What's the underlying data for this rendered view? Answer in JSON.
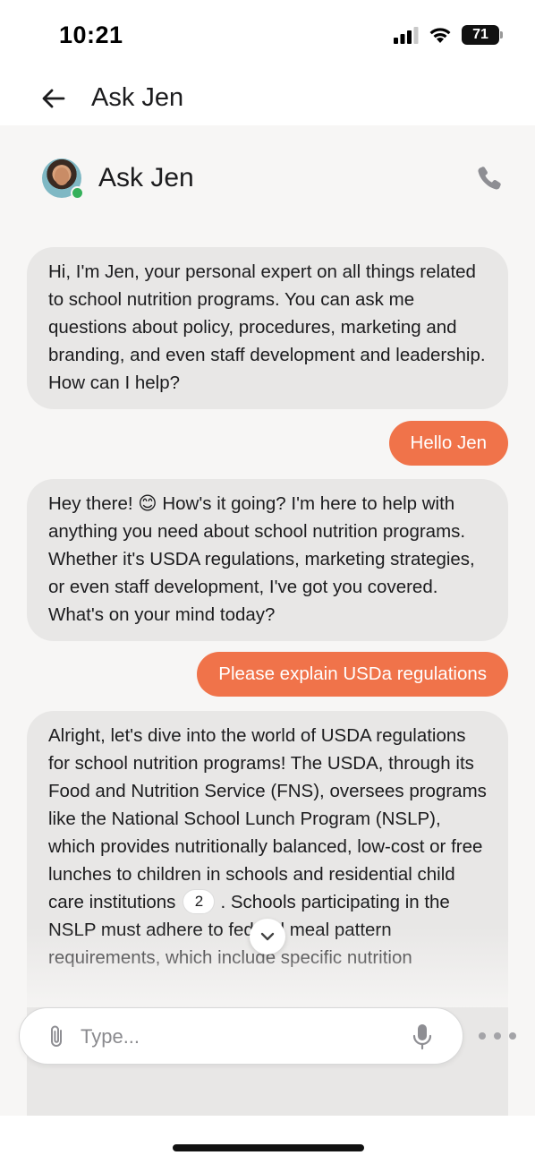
{
  "status_bar": {
    "time": "10:21",
    "battery": "71"
  },
  "nav": {
    "title": "Ask Jen",
    "back_icon": "arrow-left-icon"
  },
  "chat": {
    "agent_name": "Ask Jen",
    "agent_status": "online",
    "call_icon": "phone-icon",
    "messages": [
      {
        "role": "bot",
        "text": "Hi, I'm Jen, your personal expert on all things related to school nutrition programs. You can ask me questions about policy, procedures, marketing and branding, and even staff development and leadership. How can I help?"
      },
      {
        "role": "user",
        "text": "Hello Jen"
      },
      {
        "role": "bot",
        "text": "Hey there! 😊 How's it going? I'm here to help with anything you need about school nutrition programs. Whether it's USDA regulations, marketing strategies, or even staff development, I've got you covered. What's on your mind today?"
      },
      {
        "role": "user",
        "text": "Please explain USDa regulations"
      },
      {
        "role": "bot",
        "text_before_citation": "Alright, let's dive into the world of USDA regulations for school nutrition programs! The USDA, through its Food and Nutrition Service (FNS), oversees programs like the National School Lunch Program (NSLP), which provides nutritionally balanced, low-cost or free lunches to children in schools and residential child care institutions",
        "citation": "2",
        "text_after_citation": ". Schools participating in the NSLP must adhere to federal meal pattern requirements, which include specific nutrition"
      }
    ]
  },
  "composer": {
    "placeholder": "Type...",
    "value": "",
    "attach_icon": "paperclip-icon",
    "mic_icon": "microphone-icon",
    "more_icon": "more-horizontal-icon"
  },
  "colors": {
    "accent": "#f0734a",
    "bot_bubble": "#e8e7e6",
    "chat_background": "#f7f6f5",
    "online": "#35b05a"
  }
}
